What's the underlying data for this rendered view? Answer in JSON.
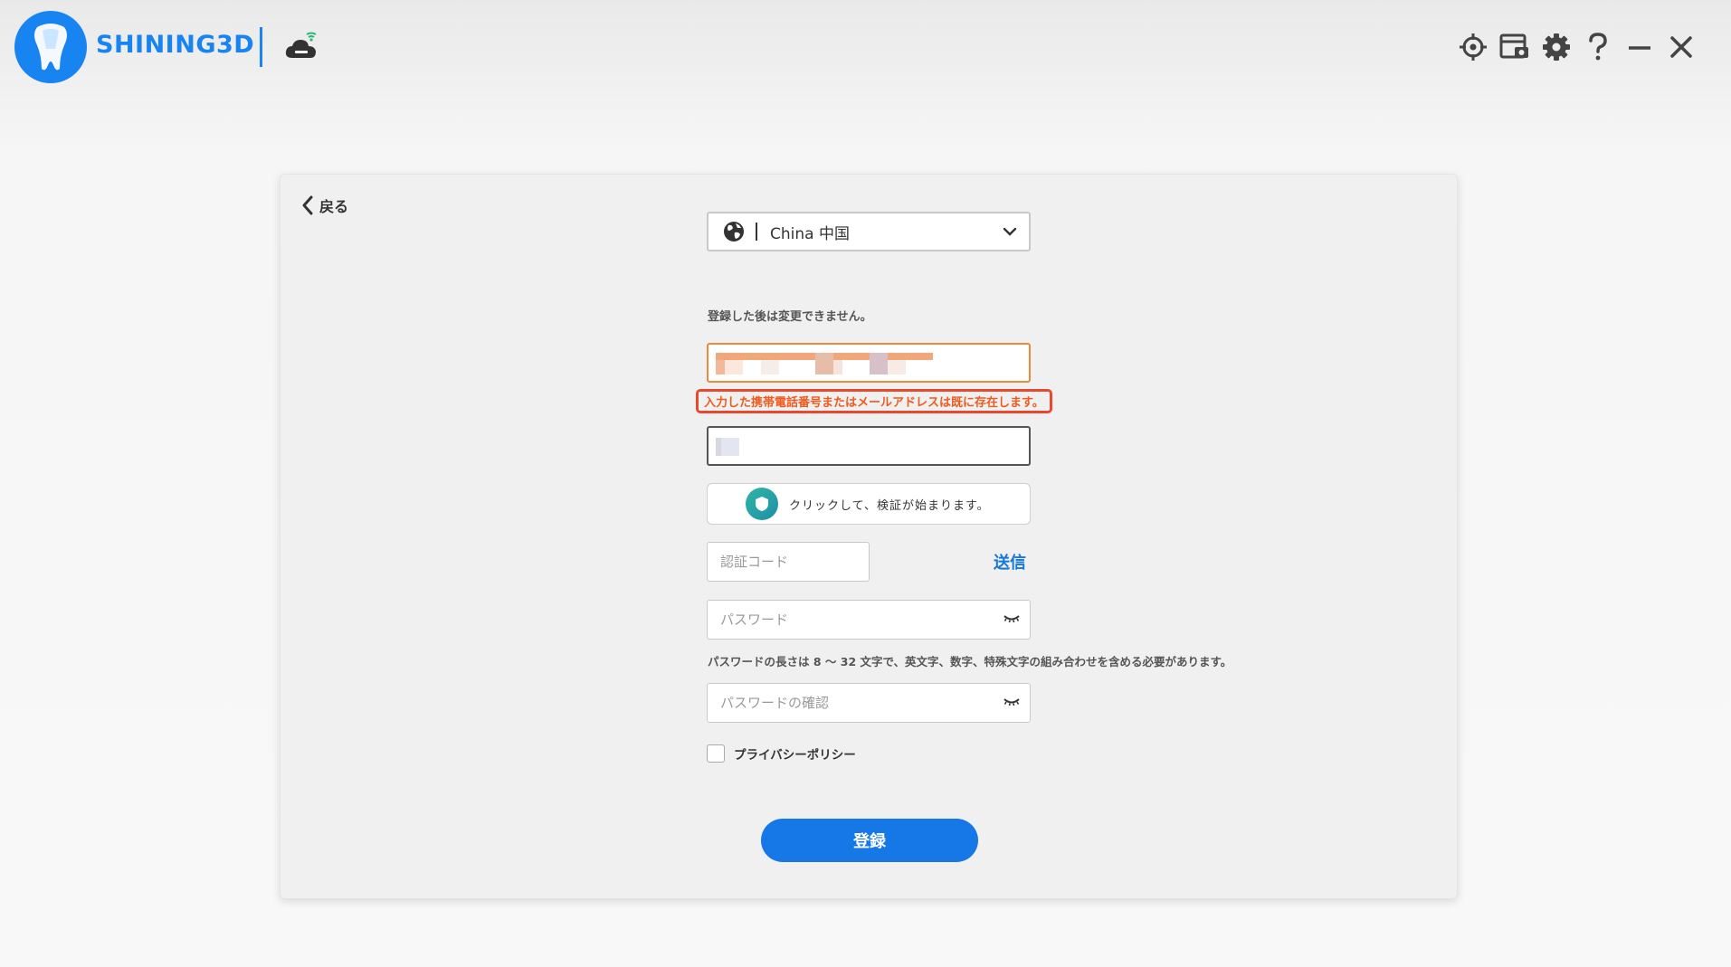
{
  "app": {
    "brand": "SHINING3D",
    "brand_color": "#1784f1",
    "icons": [
      "tooth-logo-icon",
      "cloud-wifi-icon",
      "crosshair-icon",
      "screenshot-icon",
      "gear-icon",
      "help-icon",
      "minimize-icon",
      "close-icon"
    ]
  },
  "form": {
    "back_label": "戻る",
    "region_value": "China 中国",
    "region_hint": "登録した後は変更できません。",
    "error_message": "入力した携帯電話番号またはメールアドレスは既に存在します。",
    "verify_text": "クリックして、検証が始まります。",
    "code_placeholder": "認証コード",
    "send_label": "送信",
    "password_placeholder": "パスワード",
    "password_hint": "パスワードの長さは 8 ～ 32 文字で、英文字、数字、特殊文字の組み合わせを含める必要があります。",
    "confirm_placeholder": "パスワードの確認",
    "privacy_label": "プライバシーポリシー",
    "register_label": "登録"
  },
  "colors": {
    "accent": "#1677e6",
    "error": "#ef5a1f",
    "error_border": "#e8492c"
  }
}
